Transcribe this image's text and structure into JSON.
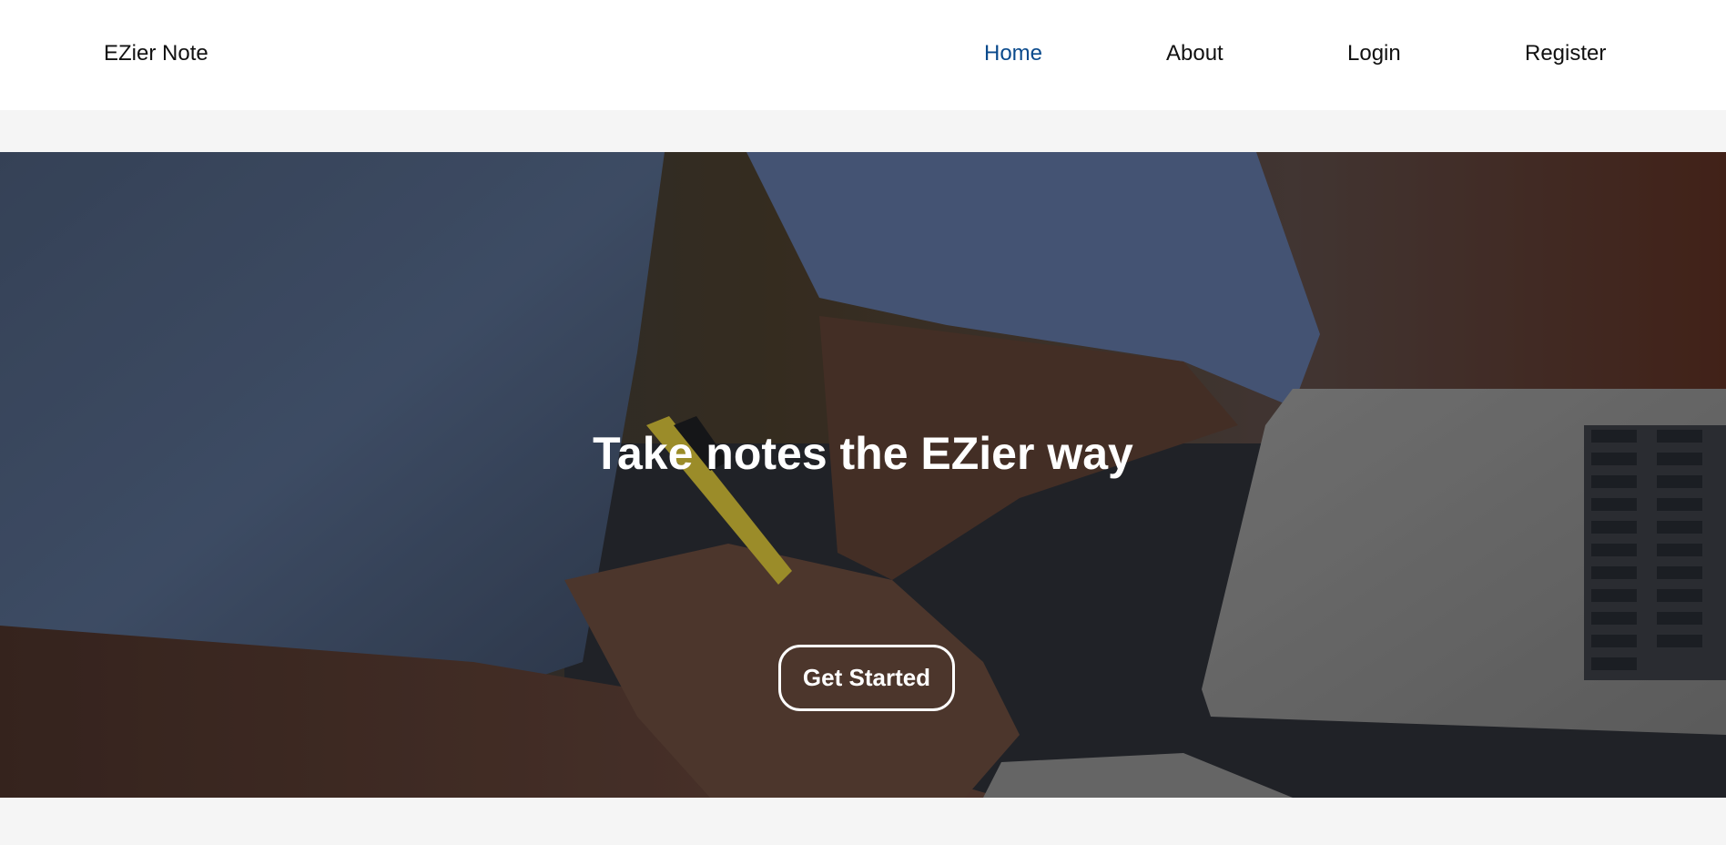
{
  "navbar": {
    "brand": "EZier Note",
    "links": [
      {
        "label": "Home",
        "active": true
      },
      {
        "label": "About",
        "active": false
      },
      {
        "label": "Login",
        "active": false
      },
      {
        "label": "Register",
        "active": false
      }
    ]
  },
  "hero": {
    "title": "Take notes the EZier way",
    "cta_label": "Get Started",
    "background_image": "photo-person-writing-with-pen-next-to-laptop"
  },
  "colors": {
    "active_link": "#0a4a8c",
    "page_background": "#f5f5f5",
    "navbar_background": "#ffffff"
  }
}
